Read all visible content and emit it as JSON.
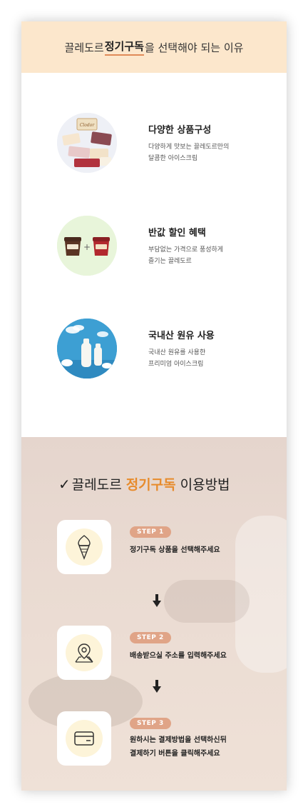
{
  "header": {
    "title_before": "끌레도르 ",
    "title_highlight": "정기구독",
    "title_after": "을 선택해야 되는 이유"
  },
  "benefits": [
    {
      "title": "다양한 상품구성",
      "desc1": "다양하게 맛보는 끌레도르만의",
      "desc2": "달콤한 아이스크림",
      "icon": "assorted-products"
    },
    {
      "title": "반값 할인 혜택",
      "desc1": "부담없는 가격으로 풍성하게",
      "desc2": "즐기는 끌레도르",
      "icon": "two-ice-cream-cups",
      "plus": "+"
    },
    {
      "title": "국내산 원유 사용",
      "desc1": "국내산 원유를 사용한",
      "desc2": "프리미엄 아이스크림",
      "icon": "milk-bottles"
    }
  ],
  "howto": {
    "check": "✓",
    "title_before": "끌레도르",
    "title_accent": "정기구독",
    "title_after": "이용방법"
  },
  "steps": [
    {
      "badge": "STEP 1",
      "line1": "정기구독 상품을 선택해주세요",
      "line2": "",
      "icon": "ice-cream-cone-icon"
    },
    {
      "badge": "STEP 2",
      "line1": "배송받으실 주소를 입력해주세요",
      "line2": "",
      "icon": "location-pin-icon"
    },
    {
      "badge": "STEP 3",
      "line1": "원하시는 결제방법을 선택하신뒤",
      "line2": "결제하기 버튼을 클릭해주세요",
      "icon": "credit-card-icon"
    }
  ],
  "colors": {
    "header_bg": "#fce7cc",
    "underline": "#e08a58",
    "accent": "#e78b2c",
    "badge": "#e0a487",
    "icon_bg": "#fdf4d9"
  }
}
